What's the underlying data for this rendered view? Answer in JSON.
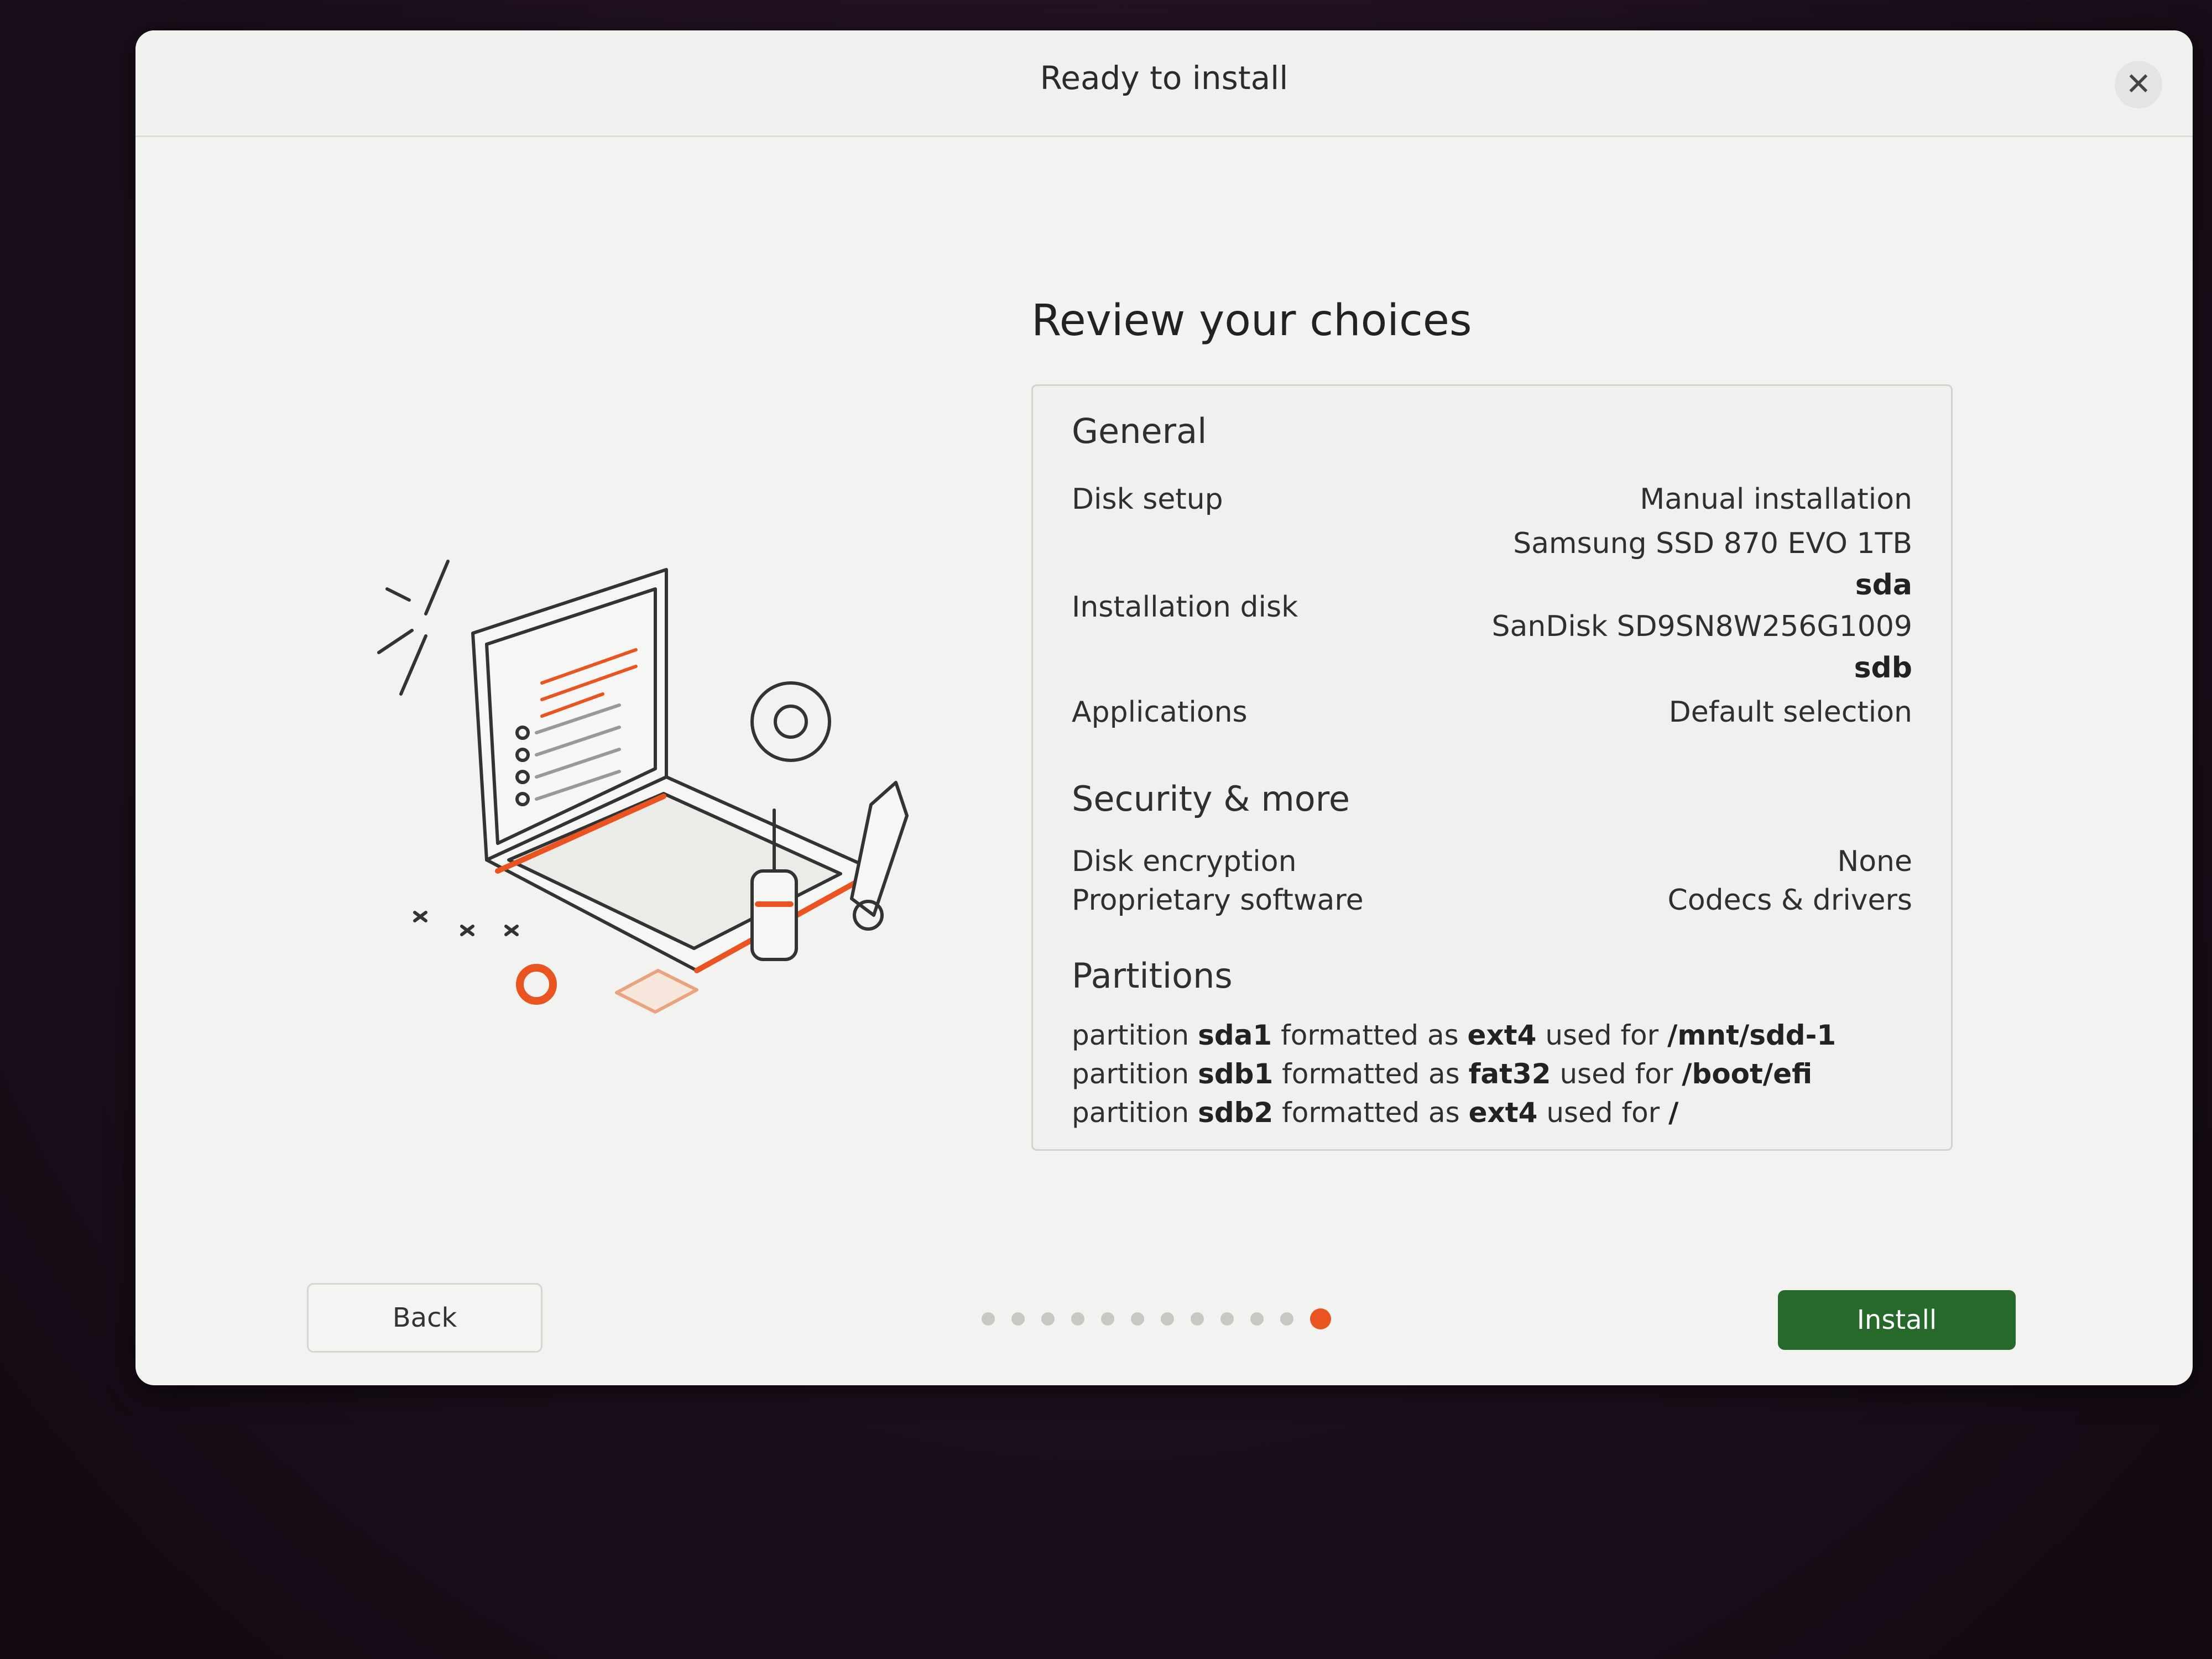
{
  "window": {
    "title": "Ready to install"
  },
  "icons": {
    "close": "close-icon",
    "illustration": "laptop-tools-illustration"
  },
  "main": {
    "heading": "Review your choices"
  },
  "review": {
    "general": {
      "title": "General",
      "disk_setup_label": "Disk setup",
      "disk_setup_value": "Manual installation",
      "installation_disk_label": "Installation disk",
      "disk1_model": "Samsung SSD 870 EVO 1TB",
      "disk1_device": "sda",
      "disk2_model": "SanDisk SD9SN8W256G1009",
      "disk2_device": "sdb",
      "applications_label": "Applications",
      "applications_value": "Default selection"
    },
    "security": {
      "title": "Security & more",
      "encryption_label": "Disk encryption",
      "encryption_value": "None",
      "proprietary_label": "Proprietary software",
      "proprietary_value": "Codecs & drivers"
    },
    "partitions": {
      "title": "Partitions",
      "word_partition": "partition",
      "word_formatted": "formatted as",
      "word_used_for": "used for",
      "items": [
        {
          "name": "sda1",
          "fs": "ext4",
          "mount": "/mnt/sdd-1"
        },
        {
          "name": "sdb1",
          "fs": "fat32",
          "mount": "/boot/efi"
        },
        {
          "name": "sdb2",
          "fs": "ext4",
          "mount": "/"
        }
      ]
    }
  },
  "footer": {
    "back_label": "Back",
    "install_label": "Install",
    "steps_total": 12,
    "current_step": 12
  },
  "colors": {
    "accent": "#e95420",
    "install_button": "#26692b",
    "background": "#f2f2f0"
  }
}
